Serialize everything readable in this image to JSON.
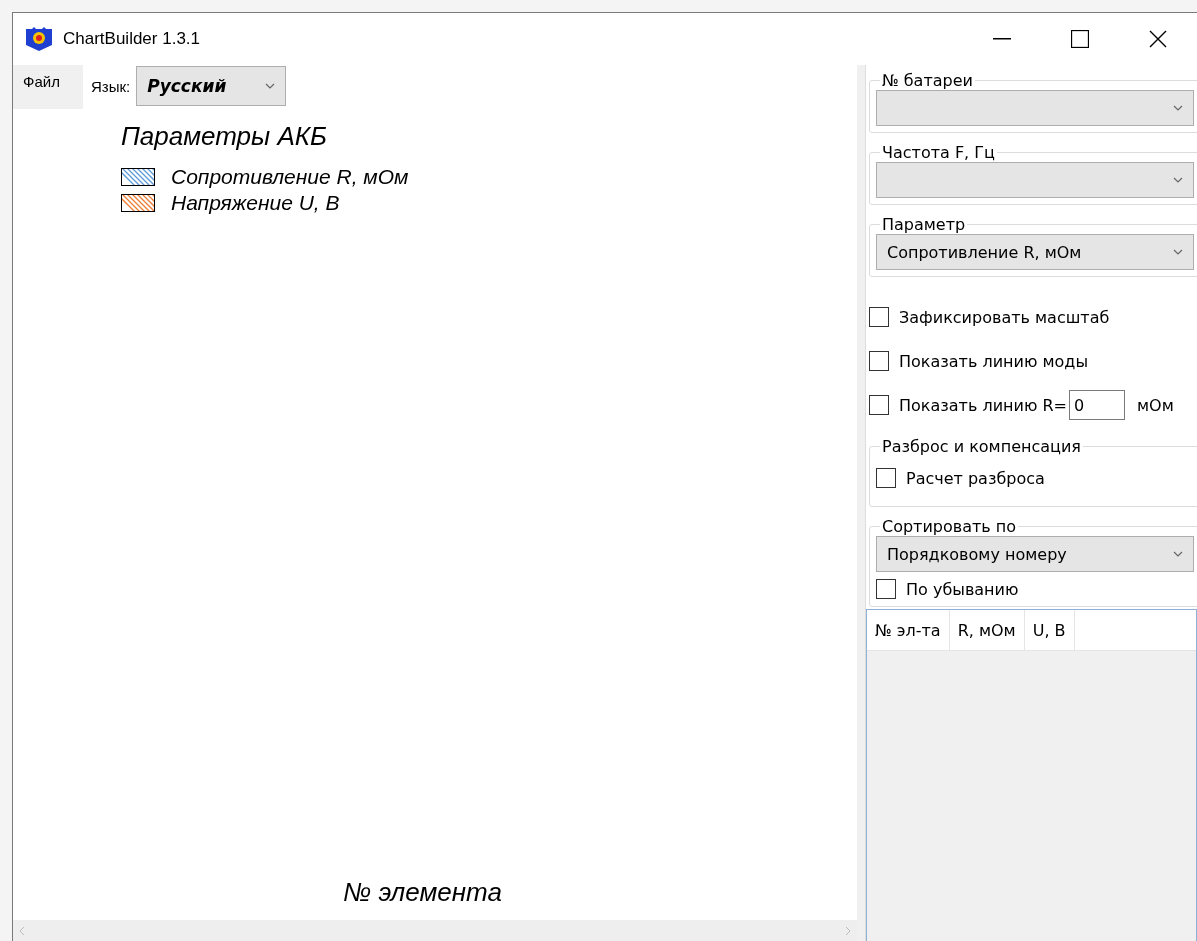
{
  "window": {
    "title": "ChartBuilder 1.3.1"
  },
  "menu": [
    {
      "label": "Файл"
    }
  ],
  "language": {
    "label": "Язык:",
    "value": "Русский"
  },
  "chart": {
    "title": "Параметры АКБ",
    "legend": [
      {
        "label": "Сопротивление R, мОм",
        "color": "#5b9bd5"
      },
      {
        "label": "Напряжение U, В",
        "color": "#ed7d31"
      }
    ],
    "xlabel": "№ элемента"
  },
  "battery": {
    "legend": "№ батареи"
  },
  "frequency": {
    "legend": "Частота F, Гц"
  },
  "parameter": {
    "legend": "Параметр",
    "value": "Сопротивление R, мОм"
  },
  "options": [
    {
      "kind": "checkbox",
      "label": "Зафиксировать масштаб",
      "checked": false
    },
    {
      "kind": "checkbox",
      "label": "Показать линию моды",
      "checked": false
    },
    {
      "kind": "checkbox-input",
      "label": "Показать линию R=",
      "value": "0",
      "unit": "мОм",
      "checked": false
    }
  ],
  "spread": {
    "legend": "Разброс и компенсация",
    "checkbox": {
      "label": "Расчет разброса",
      "checked": false
    }
  },
  "sort": {
    "legend": "Сортировать по",
    "value": "Порядковому номеру",
    "checkbox": {
      "label": "По убыванию",
      "checked": false
    }
  },
  "table": {
    "columns": [
      "№ эл-та",
      "R, мОм",
      "U, В"
    ]
  }
}
